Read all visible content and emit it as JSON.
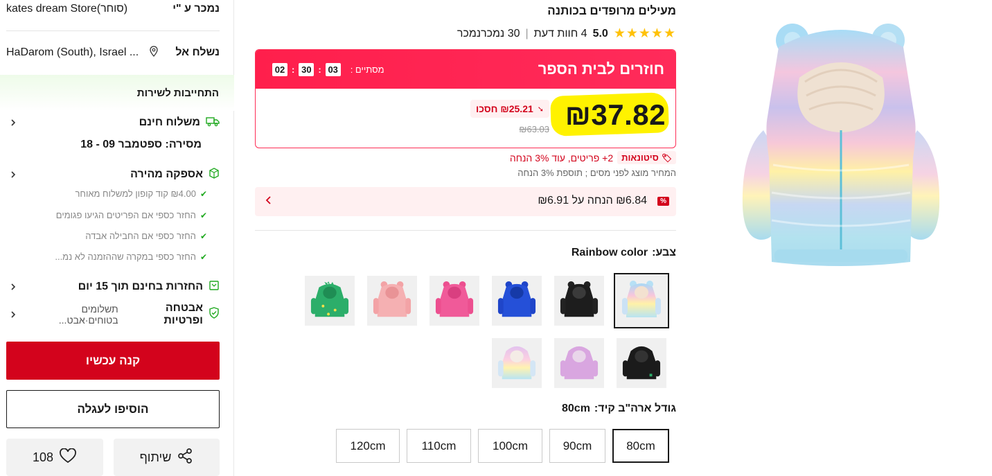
{
  "seller": {
    "label": "נמכר ע \"י",
    "store": "kates dream Store(סוחר)"
  },
  "ship_to": {
    "label": "נשלח אל",
    "location": "HaDarom (South), Israel ..."
  },
  "service": {
    "title": "התחייבות לשירות",
    "free_shipping": "משלוח חינם",
    "delivery": "מסירה: ספטמבר 09 - 18",
    "fast_delivery": "אספקה מהירה",
    "benefits": [
      "₪4.00 קוד קופון למשלוח מאוחר",
      "החזר כספי אם הפריטים הגיעו פגומים",
      "החזר כספי אם החבילה אבדה",
      "החזר כספי במקרה שההזמנה לא נמ..."
    ],
    "free_returns": "החזרות בחינם תוך 15 יום",
    "security_bold": "אבטחה ופרטיות",
    "security_rest": "תשלומים בטוחים·אבט..."
  },
  "actions": {
    "buy_now": "קנה עכשיו",
    "add_to_cart": "הוסיפו לעגלה",
    "share": "שיתוף",
    "wishlist_count": "108"
  },
  "product": {
    "title_line": "מעילים מרופדים בכותנה",
    "rating": "5.0",
    "reviews": "4 חוות דעת",
    "sold": "30 נמכרנמכר",
    "stars": 5
  },
  "promo": {
    "banner_title": "חוזרים לבית הספר",
    "ends_label": "מסתיים :",
    "timer": [
      "03",
      "30",
      "02"
    ],
    "price": "₪37.82",
    "save": "₪25.21 חסכו",
    "old_price": "₪63.03"
  },
  "wholesale": {
    "badge": "סיטונאות",
    "text": "2+ פריטים, עוד 3% הנחה"
  },
  "tax_note": "המחיר מוצג לפני מסים ; תוספת 3% הנחה",
  "coupon": {
    "badge": "%",
    "text": "₪6.84 הנחה על ₪6.91"
  },
  "color": {
    "label": "צבע:",
    "value": "Rainbow color"
  },
  "size": {
    "label": "גודל ארה\"ב קיד:",
    "value": "80cm",
    "options": [
      "80cm",
      "90cm",
      "100cm",
      "110cm",
      "120cm"
    ],
    "selected": 0
  },
  "colors": {
    "accent_red": "#d3031c",
    "banner_red": "#ff1f4c",
    "highlight_yellow": "#fff200",
    "star_gold": "#ffc107"
  }
}
